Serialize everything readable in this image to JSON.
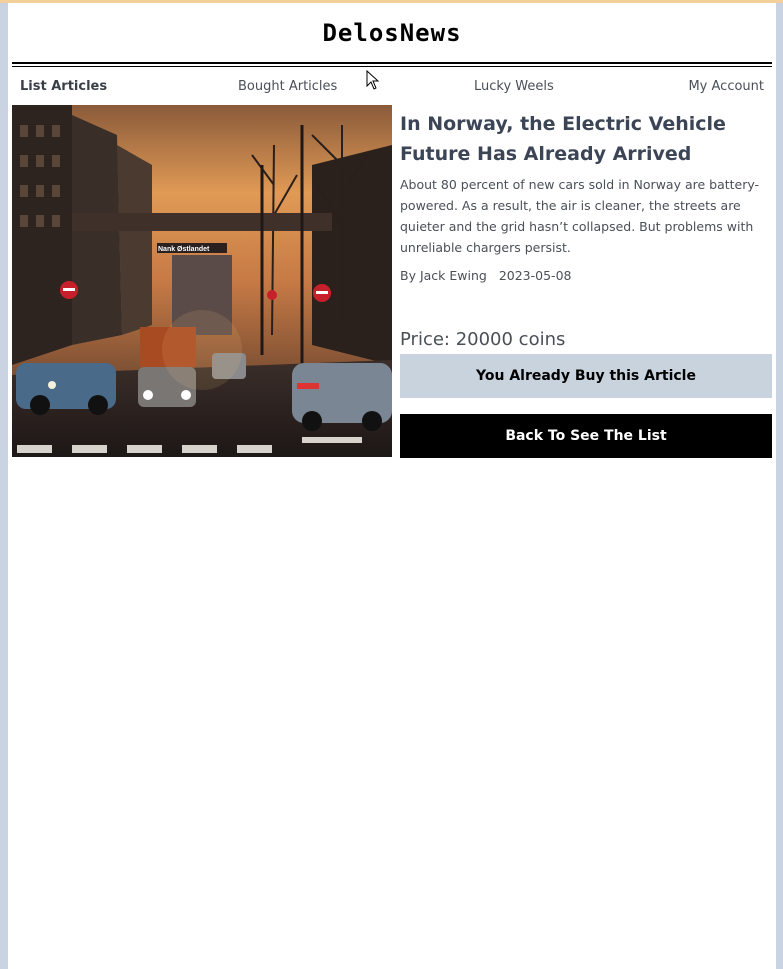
{
  "site": {
    "logo": "DelosNews"
  },
  "nav": {
    "items": [
      {
        "label": "List Articles",
        "active": true
      },
      {
        "label": "Bought Articles",
        "active": false
      },
      {
        "label": "Lucky Weels",
        "active": false
      },
      {
        "label": "My Account",
        "active": false
      }
    ]
  },
  "article": {
    "title": "In Norway, the Electric Vehicle Future Has Already Arrived",
    "summary": "About 80 percent of new cars sold in Norway are battery-powered. As a result, the air is cleaner, the streets are quieter and the grid hasn’t collapsed. But problems with unreliable chargers persist.",
    "author": "By Jack Ewing",
    "date": "2023-05-08",
    "price": "Price: 20000 coins",
    "image_sign_text": "Nank Østlandet"
  },
  "actions": {
    "bought_label": "You Already Buy this Article",
    "back_label": "Back To See The List"
  },
  "colors": {
    "page_bg": "#c9d3e1",
    "bought_button_bg": "#c9d3de",
    "back_button_bg": "#000000",
    "title_color": "#3b4556"
  }
}
